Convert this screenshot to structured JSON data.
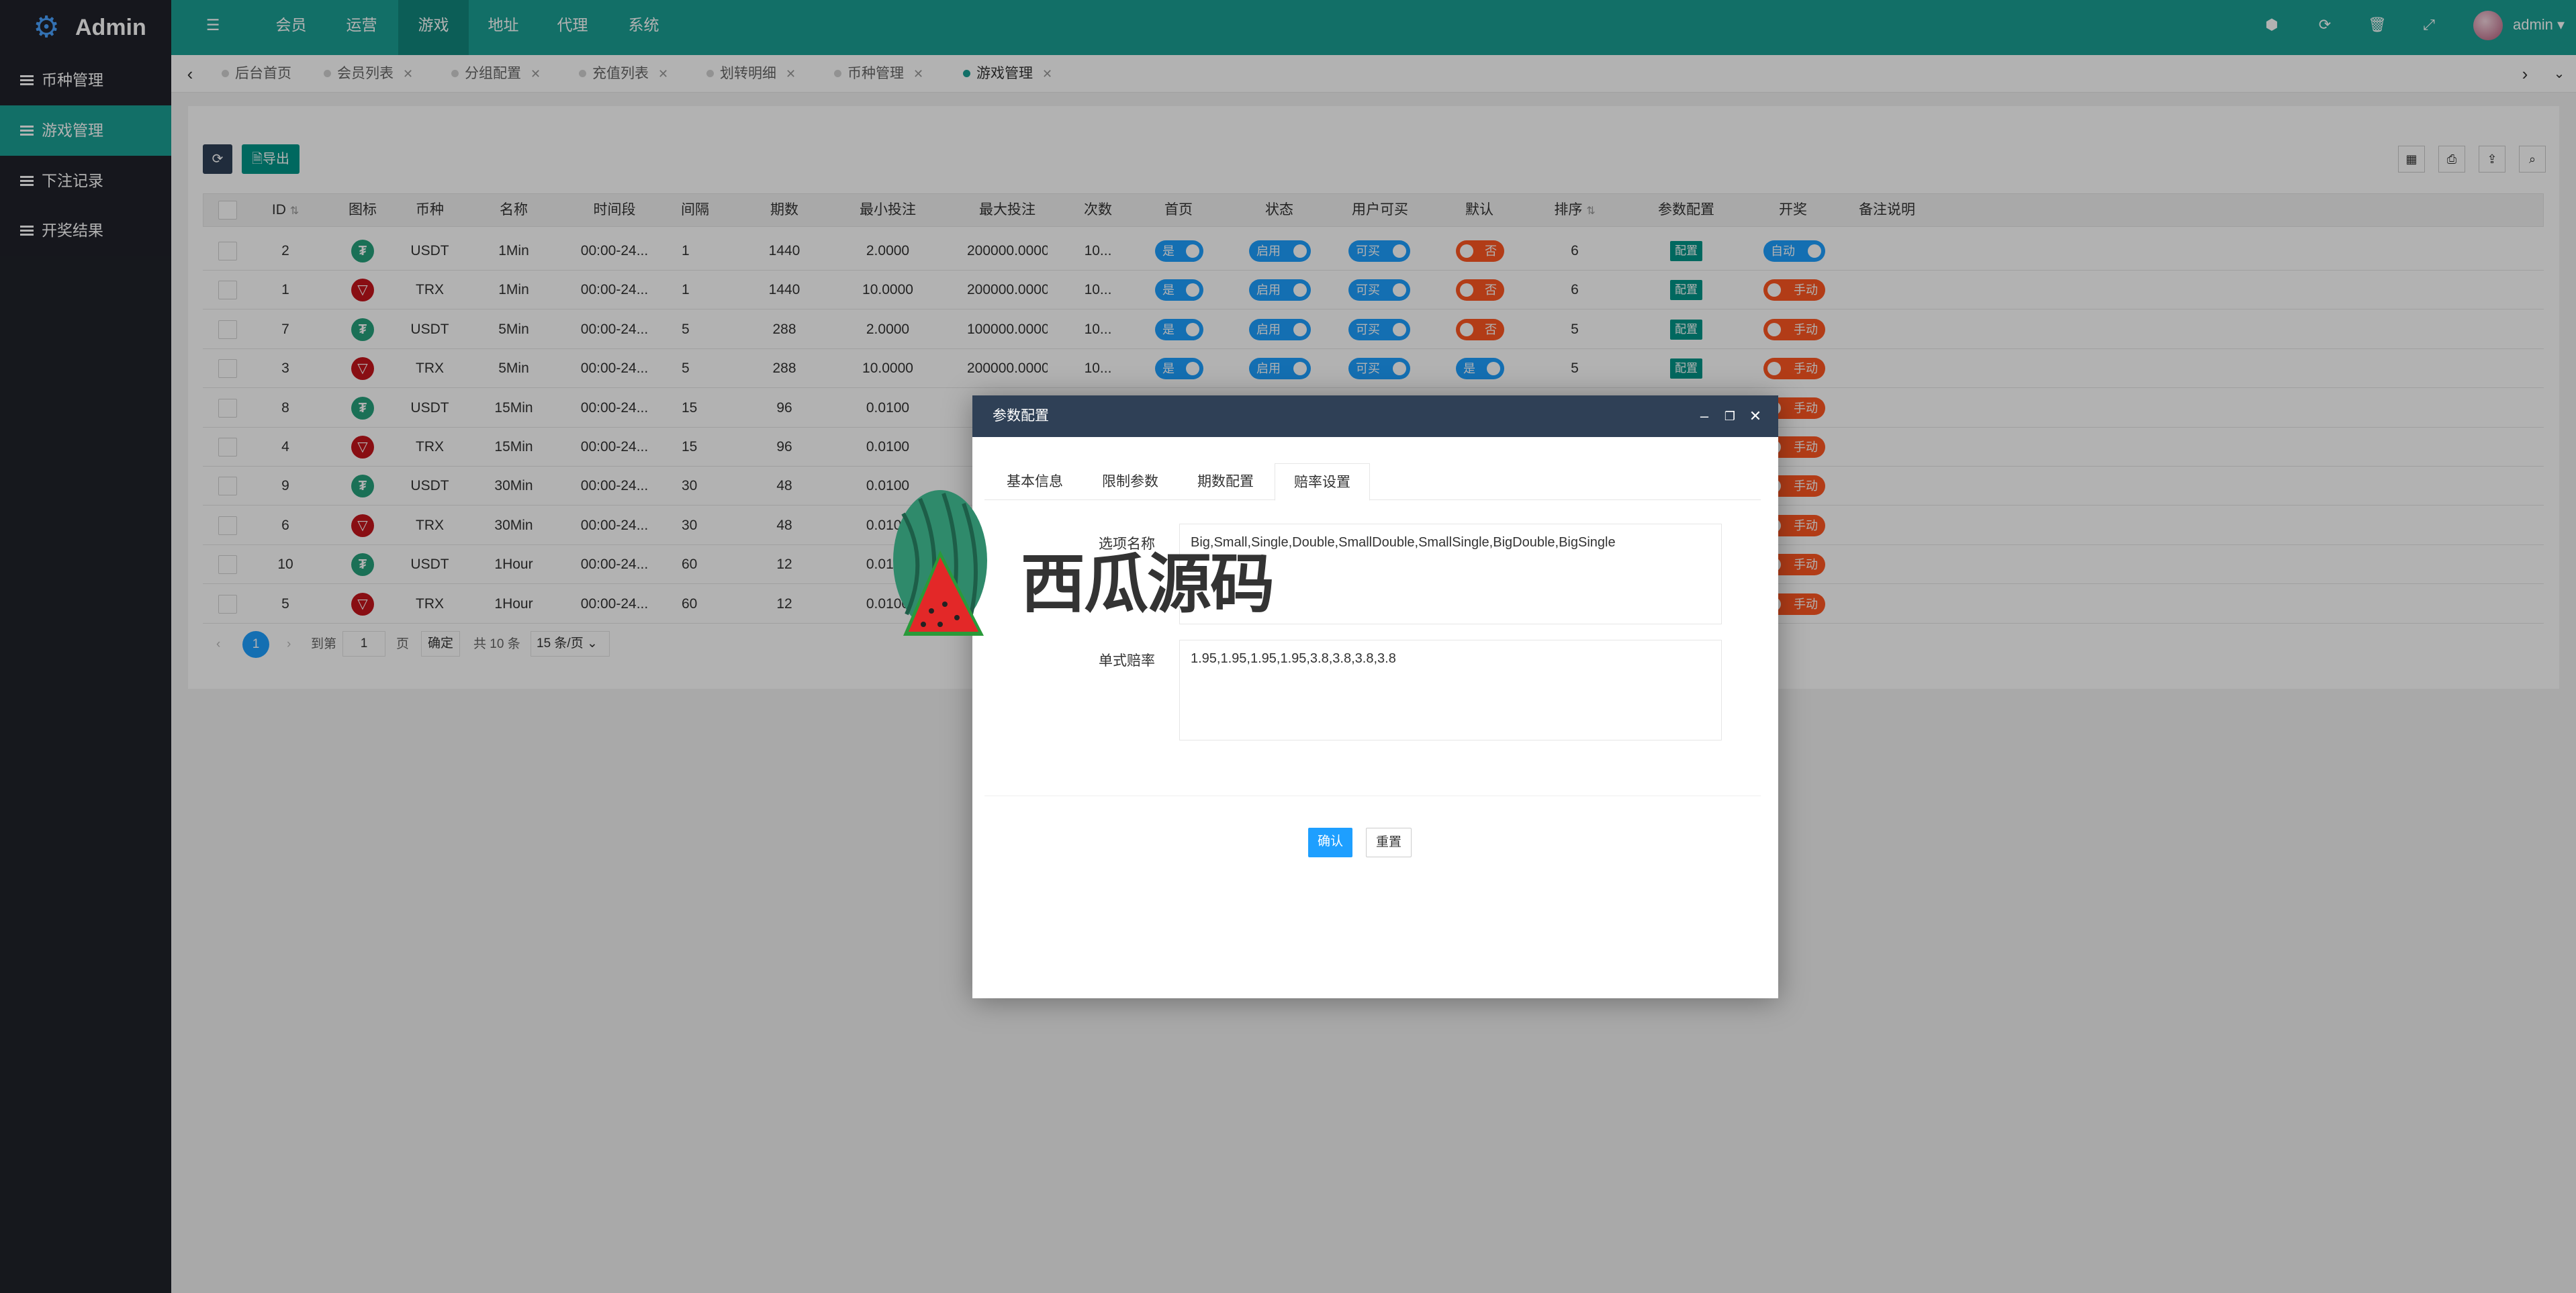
{
  "app": {
    "title": "Admin",
    "user": "admin"
  },
  "topnav": {
    "menu_icon": "menu-icon",
    "items": [
      "会员",
      "运营",
      "游戏",
      "地址",
      "代理",
      "系统"
    ],
    "active": "游戏"
  },
  "sidebar": {
    "items": [
      "币种管理",
      "游戏管理",
      "下注记录",
      "开奖结果"
    ],
    "active": "游戏管理"
  },
  "tabs": {
    "items": [
      "后台首页",
      "会员列表",
      "分组配置",
      "充值列表",
      "划转明细",
      "币种管理",
      "游戏管理"
    ],
    "active": "游戏管理"
  },
  "toolbar": {
    "refresh_icon": "refresh-icon",
    "export_label": "导出"
  },
  "table": {
    "headers": [
      "ID",
      "图标",
      "币种",
      "名称",
      "时间段",
      "间隔",
      "期数",
      "最小投注",
      "最大投注",
      "次数",
      "首页",
      "状态",
      "用户可买",
      "默认",
      "排序",
      "参数配置",
      "开奖",
      "备注说明"
    ],
    "rows": [
      {
        "id": "2",
        "coin": "USDT",
        "name": "1Min",
        "period": "00:00-24...",
        "interval": "1",
        "count": "1440",
        "min": "2.0000",
        "max": "200000.0000",
        "times": "10...",
        "home": "是",
        "status": "启用",
        "buy": "可买",
        "default": "否",
        "sort": "6",
        "config": "配置",
        "draw": "自动"
      },
      {
        "id": "1",
        "coin": "TRX",
        "name": "1Min",
        "period": "00:00-24...",
        "interval": "1",
        "count": "1440",
        "min": "10.0000",
        "max": "200000.0000",
        "times": "10...",
        "home": "是",
        "status": "启用",
        "buy": "可买",
        "default": "否",
        "sort": "6",
        "config": "配置",
        "draw": "手动"
      },
      {
        "id": "7",
        "coin": "USDT",
        "name": "5Min",
        "period": "00:00-24...",
        "interval": "5",
        "count": "288",
        "min": "2.0000",
        "max": "100000.0000",
        "times": "10...",
        "home": "是",
        "status": "启用",
        "buy": "可买",
        "default": "否",
        "sort": "5",
        "config": "配置",
        "draw": "手动"
      },
      {
        "id": "3",
        "coin": "TRX",
        "name": "5Min",
        "period": "00:00-24...",
        "interval": "5",
        "count": "288",
        "min": "10.0000",
        "max": "200000.0000",
        "times": "10...",
        "home": "是",
        "status": "启用",
        "buy": "可买",
        "default": "是",
        "sort": "5",
        "config": "配置",
        "draw": "手动"
      },
      {
        "id": "8",
        "coin": "USDT",
        "name": "15Min",
        "period": "00:00-24...",
        "interval": "15",
        "count": "96",
        "min": "0.0100",
        "draw": "手动"
      },
      {
        "id": "4",
        "coin": "TRX",
        "name": "15Min",
        "period": "00:00-24...",
        "interval": "15",
        "count": "96",
        "min": "0.0100",
        "draw": "手动"
      },
      {
        "id": "9",
        "coin": "USDT",
        "name": "30Min",
        "period": "00:00-24...",
        "interval": "30",
        "count": "48",
        "min": "0.0100",
        "draw": "手动"
      },
      {
        "id": "6",
        "coin": "TRX",
        "name": "30Min",
        "period": "00:00-24...",
        "interval": "30",
        "count": "48",
        "min": "0.0100",
        "draw": "手动"
      },
      {
        "id": "10",
        "coin": "USDT",
        "name": "1Hour",
        "period": "00:00-24...",
        "interval": "60",
        "count": "12",
        "min": "0.0100",
        "draw": "手动"
      },
      {
        "id": "5",
        "coin": "TRX",
        "name": "1Hour",
        "period": "00:00-24...",
        "interval": "60",
        "count": "12",
        "min": "0.0100",
        "draw": "手动"
      }
    ]
  },
  "pagination": {
    "current": "1",
    "goto": "到第",
    "page_input": "1",
    "page_unit": "页",
    "confirm": "确定",
    "total": "共 10 条",
    "per_page": "15 条/页"
  },
  "modal": {
    "title": "参数配置",
    "tabs": [
      "基本信息",
      "限制参数",
      "期数配置",
      "赔率设置"
    ],
    "active_tab": "赔率设置",
    "fields": [
      {
        "label": "选项名称",
        "value": "Big,Small,Single,Double,SmallDouble,SmallSingle,BigDouble,BigSingle"
      },
      {
        "label": "单式赔率",
        "value": "1.95,1.95,1.95,1.95,3.8,3.8,3.8,3.8"
      }
    ],
    "confirm": "确认",
    "reset": "重置"
  },
  "watermark": {
    "text": "西瓜源码"
  },
  "colors": {
    "header": "#1aa094",
    "sidebar": "#20222a",
    "switch_on": "#1e9fff",
    "switch_off": "#ff5722",
    "modal_head": "#2f4056"
  }
}
